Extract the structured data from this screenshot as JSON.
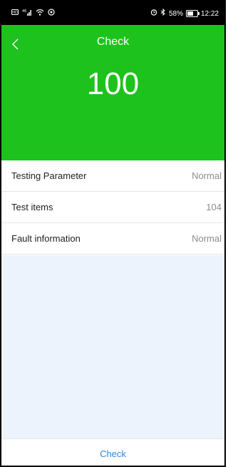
{
  "status_bar": {
    "left_icons": [
      "sim-card-icon",
      "signal-icon",
      "wifi-icon",
      "nfc-icon"
    ],
    "alarm_icon": "alarm-icon",
    "bluetooth_icon": "bluetooth-icon",
    "battery_text": "58%",
    "battery_level": 0.58,
    "time": "12:22"
  },
  "header": {
    "back_icon": "chevron-left-icon",
    "title": "Check",
    "score": "100",
    "color": "#1dc21d"
  },
  "items": [
    {
      "label": "Testing Parameter",
      "value": "Normal"
    },
    {
      "label": "Test items",
      "value": "104"
    },
    {
      "label": "Fault information",
      "value": "Normal"
    }
  ],
  "footer": {
    "check_label": "Check",
    "accent": "#2f86d8"
  }
}
